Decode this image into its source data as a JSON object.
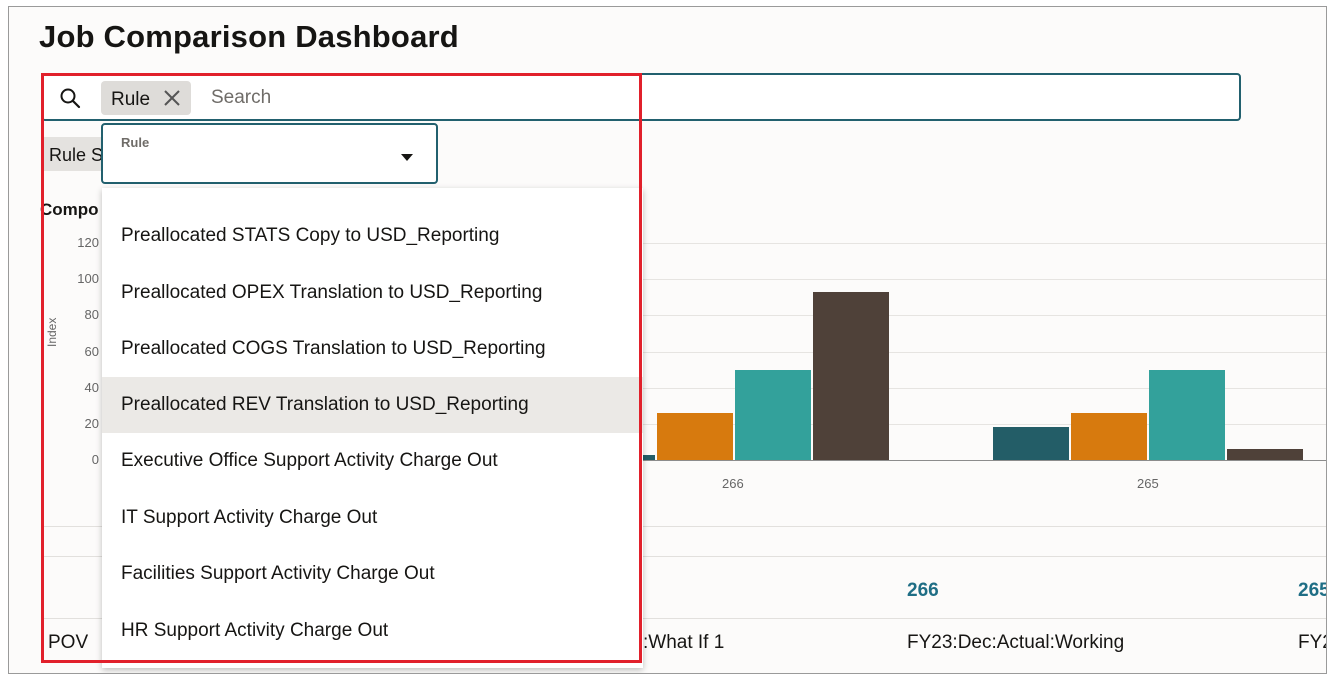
{
  "page": {
    "title": "Job Comparison Dashboard"
  },
  "search": {
    "chip_label": "Rule",
    "placeholder": "Search"
  },
  "filter_chip_partial": "Rule S",
  "compare_partial": "Compo",
  "dropdown": {
    "label": "Rule",
    "value": "",
    "options": [
      "Preallocated STATS Copy to USD_Reporting",
      "Preallocated OPEX Translation to USD_Reporting",
      "Preallocated COGS Translation to USD_Reporting",
      "Preallocated REV Translation to USD_Reporting",
      "Executive Office Support Activity Charge Out",
      "IT Support Activity Charge Out",
      "Facilities Support Activity Charge Out",
      "HR Support Activity Charge Out"
    ],
    "highlighted_index": 3
  },
  "chart_data": {
    "type": "bar",
    "ylabel": "Index",
    "ylim": [
      0,
      120
    ],
    "yticks": [
      "120",
      "100",
      "80",
      "60",
      "40",
      "20",
      "0"
    ],
    "categories": [
      "266",
      "265"
    ],
    "series": [
      {
        "color": "#235d67",
        "values": [
          3,
          18
        ]
      },
      {
        "color": "#d77a0e",
        "values": [
          26,
          26
        ]
      },
      {
        "color": "#33a19b",
        "values": [
          50,
          50
        ]
      },
      {
        "color": "#4f4139",
        "values": [
          93,
          6
        ]
      }
    ]
  },
  "table": {
    "columns": [
      "266",
      "265"
    ],
    "row_label": "POV",
    "row_values": [
      ":What If 1",
      "FY23:Dec:Actual:Working",
      "FY2"
    ]
  }
}
